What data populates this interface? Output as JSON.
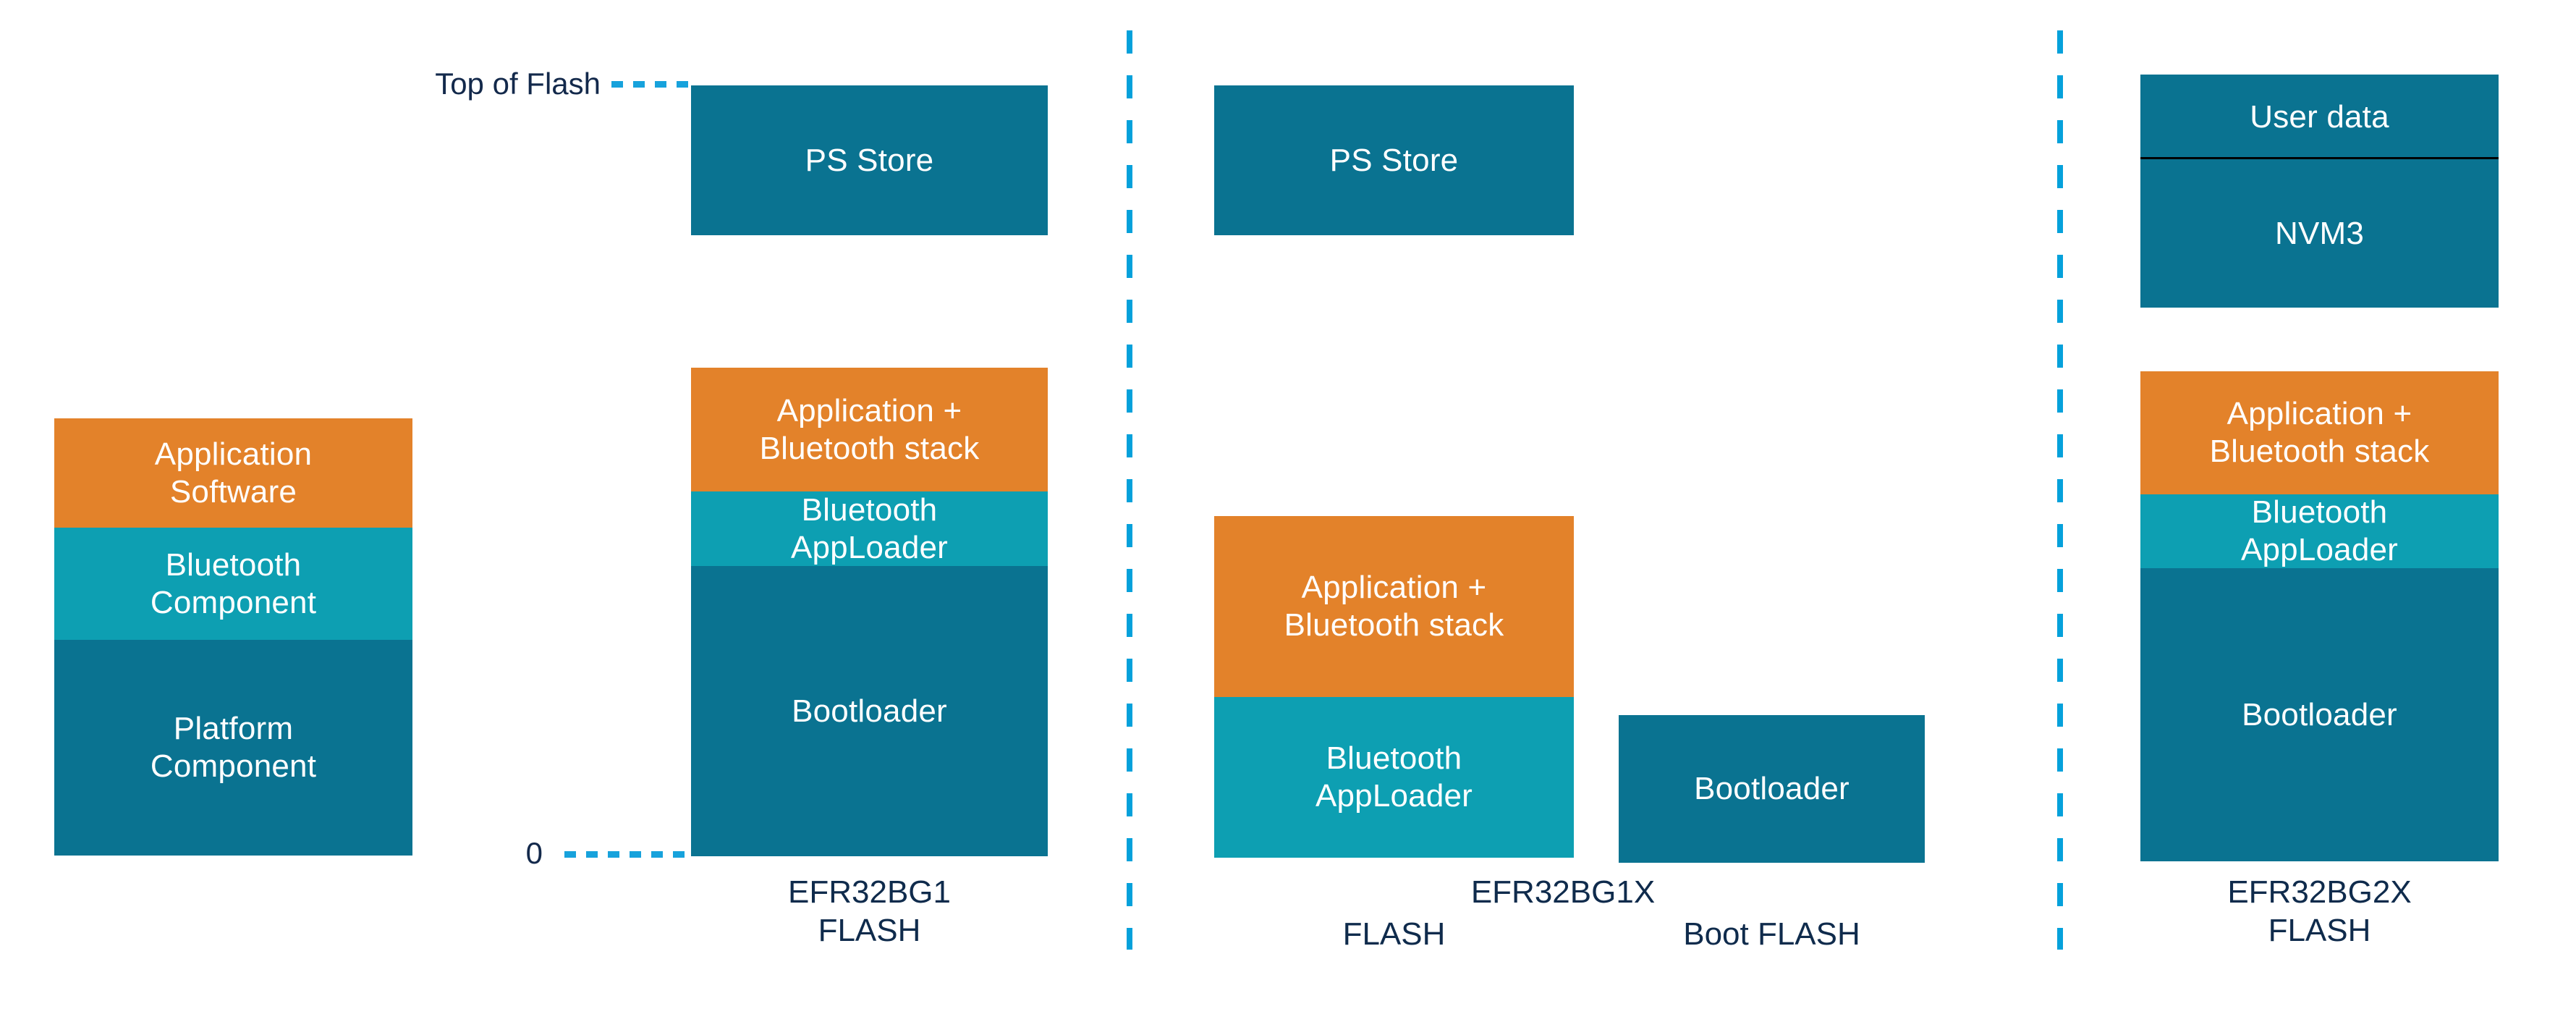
{
  "diagram": {
    "title_text": "",
    "colors": {
      "orange": "#E3822A",
      "teal": "#0D9FB2",
      "dark_teal": "#0A7391",
      "accent_blue": "#05A1DB",
      "label_navy": "#0F2B4C",
      "rule_black": "#000000",
      "background": "#FFFFFF"
    },
    "markers": {
      "top_of_flash": "Top of Flash",
      "zero": "0"
    },
    "panels": [
      {
        "id": "components",
        "caption": "",
        "blocks": [
          {
            "id": "application-software",
            "label": "Application\nSoftware",
            "color": "orange"
          },
          {
            "id": "bluetooth-component",
            "label": "Bluetooth\nComponent",
            "color": "teal"
          },
          {
            "id": "platform-component",
            "label": "Platform\nComponent",
            "color": "dark"
          }
        ]
      },
      {
        "id": "efr32bg1",
        "caption": "EFR32BG1\nFLASH",
        "blocks": [
          {
            "id": "ps-store",
            "label": "PS Store",
            "color": "dark"
          },
          {
            "id": "application-bluetooth-stack",
            "label": "Application +\nBluetooth stack",
            "color": "orange"
          },
          {
            "id": "bluetooth-apploader",
            "label": "Bluetooth\nAppLoader",
            "color": "teal"
          },
          {
            "id": "bootloader",
            "label": "Bootloader",
            "color": "dark"
          }
        ]
      },
      {
        "id": "efr32bg1x",
        "caption": "EFR32BG1X",
        "sub_captions": {
          "main_flash": "FLASH",
          "boot_flash": "Boot FLASH"
        },
        "blocks": [
          {
            "id": "ps-store",
            "label": "PS Store",
            "color": "dark"
          },
          {
            "id": "application-bluetooth-stack",
            "label": "Application +\nBluetooth stack",
            "color": "orange"
          },
          {
            "id": "bluetooth-apploader",
            "label": "Bluetooth\nAppLoader",
            "color": "teal"
          },
          {
            "id": "bootloader",
            "label": "Bootloader",
            "color": "dark"
          }
        ]
      },
      {
        "id": "efr32bg2x",
        "caption": "EFR32BG2X\nFLASH",
        "blocks": [
          {
            "id": "user-data",
            "label": "User data",
            "color": "dark"
          },
          {
            "id": "nvm3",
            "label": "NVM3",
            "color": "dark"
          },
          {
            "id": "application-bluetooth-stack",
            "label": "Application +\nBluetooth stack",
            "color": "orange"
          },
          {
            "id": "bluetooth-apploader",
            "label": "Bluetooth\nAppLoader",
            "color": "teal"
          },
          {
            "id": "bootloader",
            "label": "Bootloader",
            "color": "dark"
          }
        ]
      }
    ]
  }
}
